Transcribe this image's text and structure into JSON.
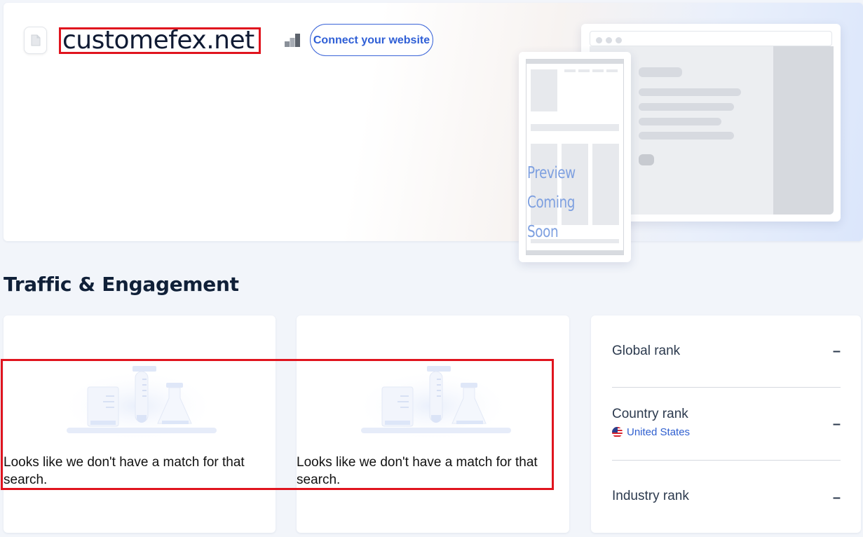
{
  "header": {
    "domain": "customefex.net",
    "connect_button": "Connect your website"
  },
  "preview": {
    "line1": "Preview",
    "line2": "Coming Soon"
  },
  "section": {
    "title": "Traffic & Engagement"
  },
  "cards": [
    {
      "empty_message": "Looks like we don't have a match for that search."
    },
    {
      "empty_message": "Looks like we don't have a match for that search."
    }
  ],
  "ranks": {
    "global": {
      "label": "Global rank",
      "value": "–"
    },
    "country": {
      "label": "Country rank",
      "value": "–",
      "country": "United States"
    },
    "industry": {
      "label": "Industry rank",
      "value": "–"
    }
  },
  "colors": {
    "accent": "#2f5fd6",
    "highlight_box": "#e0141e",
    "background": "#f2f5fa"
  }
}
